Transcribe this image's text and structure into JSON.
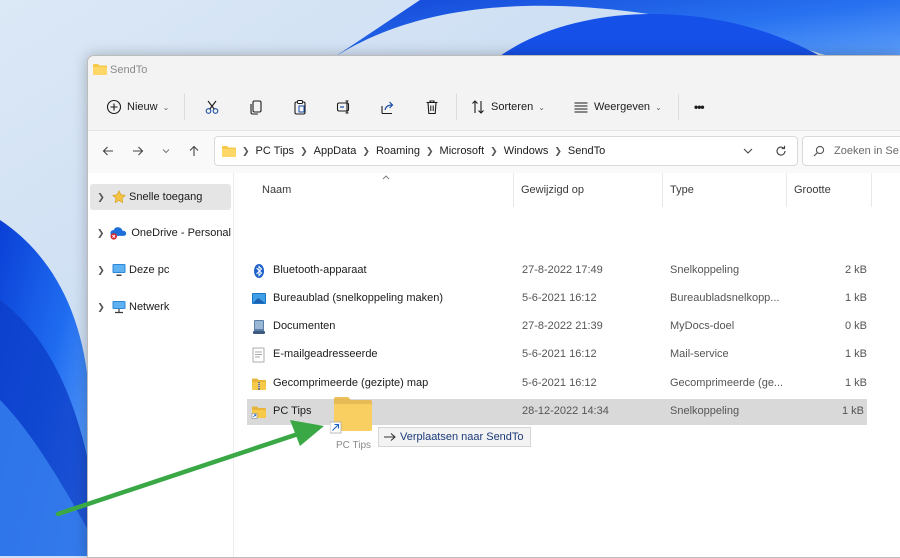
{
  "window": {
    "title": "SendTo"
  },
  "toolbar": {
    "new_label": "Nieuw",
    "sort_label": "Sorteren",
    "view_label": "Weergeven",
    "more_label": "•••"
  },
  "address": {
    "crumbs": [
      "PC Tips",
      "AppData",
      "Roaming",
      "Microsoft",
      "Windows",
      "SendTo"
    ],
    "search_placeholder": "Zoeken in Se"
  },
  "navpane": {
    "items": [
      {
        "label": "Snelle toegang",
        "icon": "star-icon"
      },
      {
        "label": "OneDrive - Personal",
        "icon": "onedrive-cloud-icon"
      },
      {
        "label": "Deze pc",
        "icon": "monitor-icon"
      },
      {
        "label": "Netwerk",
        "icon": "network-icon"
      }
    ]
  },
  "columns": {
    "name": "Naam",
    "modified": "Gewijzigd op",
    "type": "Type",
    "size": "Grootte"
  },
  "files": [
    {
      "name": "Bluetooth-apparaat",
      "modified": "27-8-2022 17:49",
      "type": "Snelkoppeling",
      "size": "2 kB",
      "icon": "bluetooth-icon"
    },
    {
      "name": "Bureaublad (snelkoppeling maken)",
      "modified": "5-6-2021 16:12",
      "type": "Bureaubladsnelkopp...",
      "size": "1 kB",
      "icon": "desktop-icon"
    },
    {
      "name": "Documenten",
      "modified": "27-8-2022 21:39",
      "type": "MyDocs-doel",
      "size": "0 kB",
      "icon": "documents-icon"
    },
    {
      "name": "E-mailgeadresseerde",
      "modified": "5-6-2021 16:12",
      "type": "Mail-service",
      "size": "1 kB",
      "icon": "mail-icon"
    },
    {
      "name": "Gecomprimeerde (gezipte) map",
      "modified": "5-6-2021 16:12",
      "type": "Gecomprimeerde (ge...",
      "size": "1 kB",
      "icon": "zip-folder-icon"
    },
    {
      "name": "PC Tips",
      "modified": "28-12-2022 14:34",
      "type": "Snelkoppeling",
      "size": "1 kB",
      "icon": "folder-shortcut-icon",
      "selected": true
    }
  ],
  "drag": {
    "label": "PC Tips",
    "tooltip": "Verplaatsen naar SendTo"
  },
  "colors": {
    "accent": "#0067c0",
    "arrow": "#3aa845",
    "folder": "#f7c948",
    "selected_row": "#d9d9d9"
  }
}
